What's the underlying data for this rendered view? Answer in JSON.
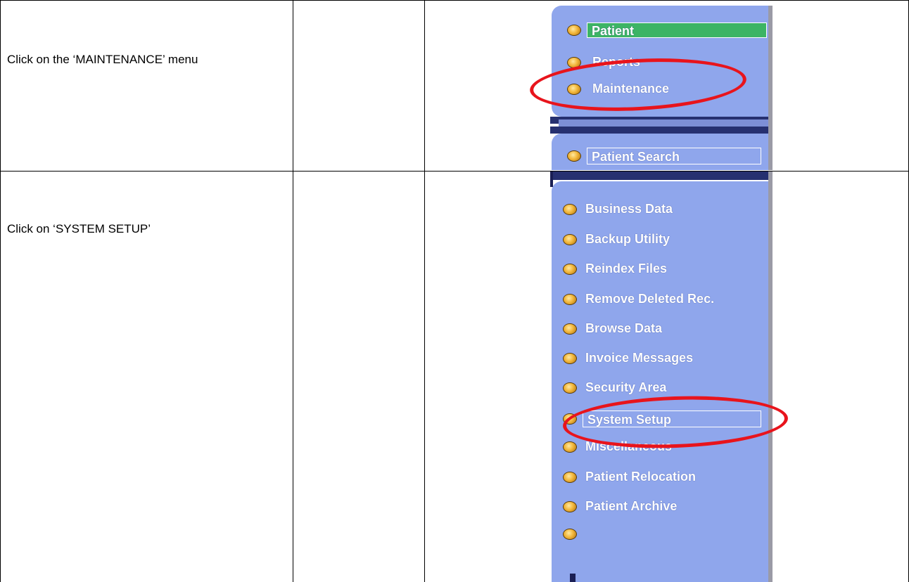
{
  "rows": [
    {
      "instruction": "Click on the ‘MAINTENANCE’ menu"
    },
    {
      "instruction": "Click on ‘SYSTEM SETUP’"
    }
  ],
  "top_menu": {
    "items": [
      {
        "label": "Patient",
        "state": "active"
      },
      {
        "label": "Reports",
        "state": "normal"
      },
      {
        "label": "Maintenance",
        "state": "highlighted"
      }
    ],
    "search_label": "Patient Search"
  },
  "maintenance_menu": {
    "items": [
      {
        "label": "Business Data"
      },
      {
        "label": "Backup Utility"
      },
      {
        "label": "Reindex Files"
      },
      {
        "label": "Remove Deleted Rec."
      },
      {
        "label": "Browse Data"
      },
      {
        "label": "Invoice Messages"
      },
      {
        "label": "Security Area"
      },
      {
        "label": "System Setup",
        "state": "highlighted"
      },
      {
        "label": "Miscellaneous"
      },
      {
        "label": "Patient Relocation"
      },
      {
        "label": "Patient Archive"
      },
      {
        "label": ""
      }
    ]
  },
  "colors": {
    "panel": "#8fa6ec",
    "active_item": "#3cb464",
    "highlight": "#e8141c",
    "bullet": "#f2b63a"
  },
  "icons": {
    "menu_bullet": "orb-bullet-icon"
  }
}
